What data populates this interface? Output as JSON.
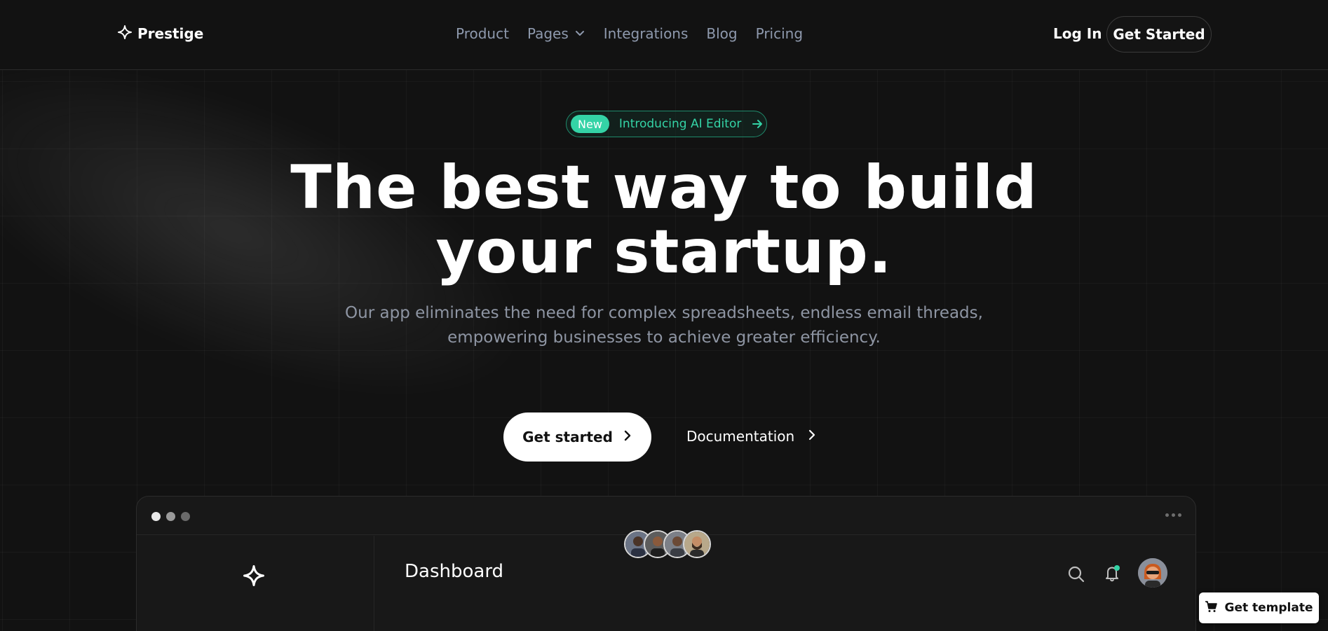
{
  "brand": {
    "name": "Prestige",
    "logo_icon": "sparkle-icon"
  },
  "nav": {
    "items": [
      {
        "label": "Product"
      },
      {
        "label": "Pages",
        "has_dropdown": true
      },
      {
        "label": "Integrations"
      },
      {
        "label": "Blog"
      },
      {
        "label": "Pricing"
      }
    ],
    "login_label": "Log In",
    "cta_label": "Get Started"
  },
  "hero": {
    "badge_new": "New",
    "badge_text": "Introducing AI Editor",
    "title_line1": "The best way to build",
    "title_line2": "your startup.",
    "subtitle_line1": "Our app eliminates the need for complex spreadsheets, endless email threads,",
    "subtitle_line2": "empowering businesses to achieve greater efficiency.",
    "primary_cta": "Get started",
    "secondary_cta": "Documentation"
  },
  "dashboard_preview": {
    "title": "Dashboard",
    "collaborator_count": 4,
    "notification_dot_color": "#34d3a6"
  },
  "floating": {
    "get_template_label": "Get template"
  },
  "colors": {
    "background": "#121212",
    "accent": "#34d3a6",
    "nav_text": "#8e99ad",
    "subtitle_text": "#8e95a3"
  }
}
